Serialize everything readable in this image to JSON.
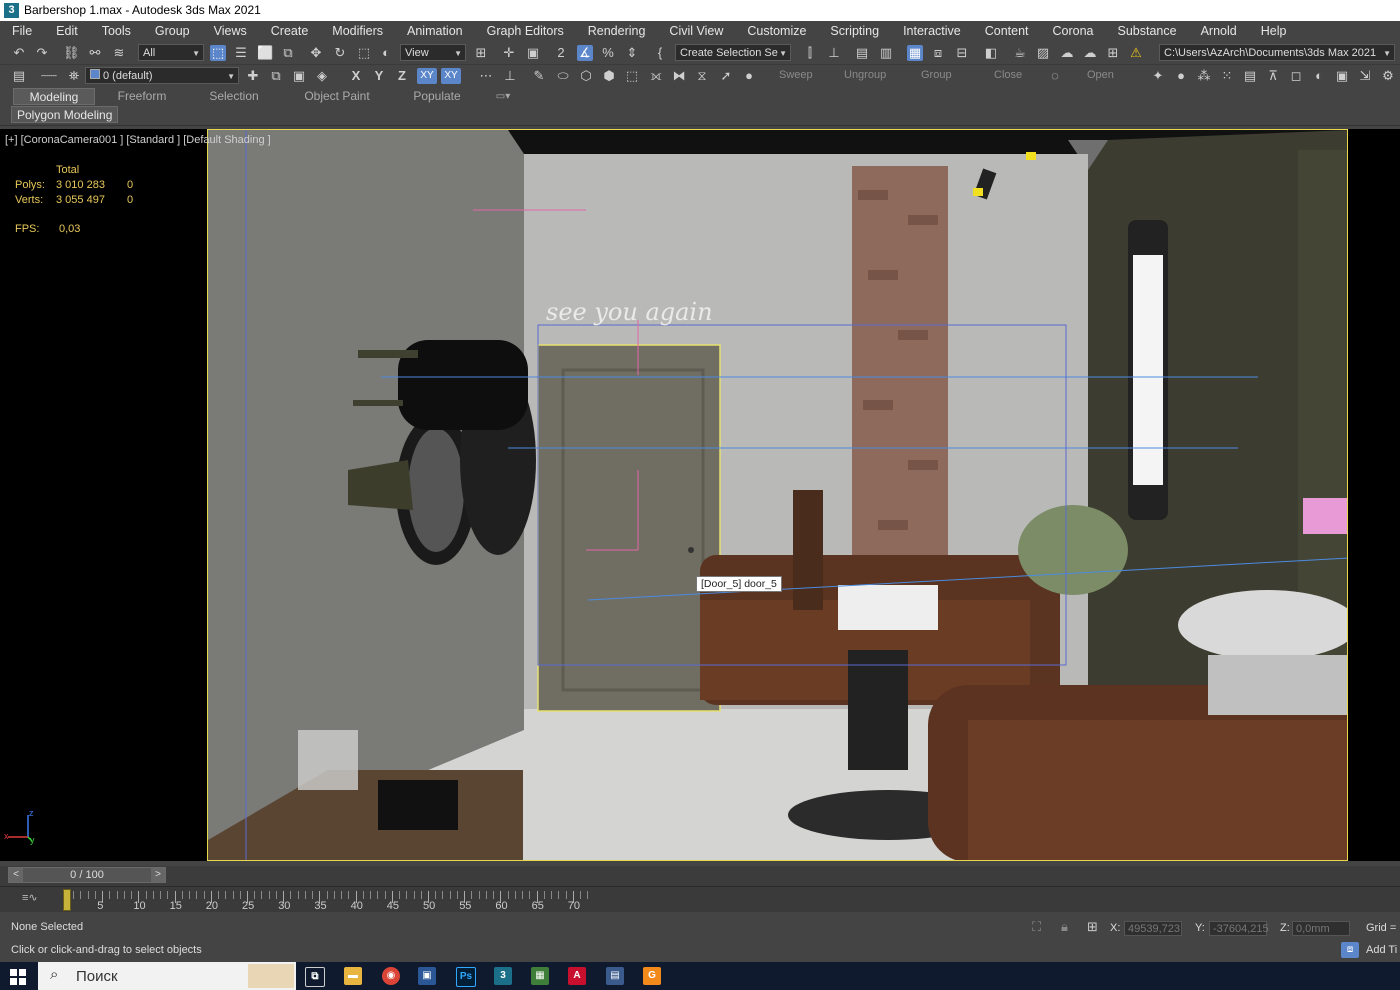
{
  "window": {
    "title": "Barbershop 1.max - Autodesk 3ds Max 2021",
    "app_icon": "3"
  },
  "menu": [
    "File",
    "Edit",
    "Tools",
    "Group",
    "Views",
    "Create",
    "Modifiers",
    "Animation",
    "Graph Editors",
    "Rendering",
    "Civil View",
    "Customize",
    "Scripting",
    "Interactive",
    "Content",
    "Corona",
    "Substance",
    "Arnold",
    "Help"
  ],
  "toolbar1": {
    "filter_select": "All",
    "ref_coord": "View",
    "named_selection": "Create Selection Se",
    "project_path": "C:\\Users\\AzArch\\Documents\\3ds Max 2021"
  },
  "toolbar2": {
    "layer": "0 (default)",
    "axis_x": "X",
    "axis_y": "Y",
    "axis_z": "Z",
    "plane_xy": "XY",
    "plane_xy2": "XY",
    "sweep": "Sweep",
    "ungroup": "Ungroup",
    "group": "Group",
    "close": "Close",
    "open": "Open"
  },
  "ribbon": {
    "tabs": [
      "Modeling",
      "Freeform",
      "Selection",
      "Object Paint",
      "Populate"
    ],
    "active_tab": "Modeling",
    "panel_label": "Polygon Modeling"
  },
  "viewport": {
    "label": "[+] [CoronaCamera001 ] [Standard ] [Default Shading ]",
    "stats": {
      "header": "Total",
      "polys_label": "Polys:",
      "polys_total": "3 010 283",
      "polys_sel": "0",
      "verts_label": "Verts:",
      "verts_total": "3 055 497",
      "verts_sel": "0",
      "fps_label": "FPS:",
      "fps_value": "0,03"
    },
    "tooltip": "[Door_5] door_5",
    "scene_text": "see you again",
    "axis_labels": {
      "z": "z",
      "x": "x",
      "y": "y"
    }
  },
  "timeline": {
    "frame_display": "0 / 100",
    "prev": "<",
    "next": ">",
    "tick_labels": [
      "0",
      "5",
      "10",
      "15",
      "20",
      "25",
      "30",
      "35",
      "40",
      "45",
      "50",
      "55",
      "60",
      "65",
      "70"
    ]
  },
  "status": {
    "selection": "None Selected",
    "prompt": "Click or click-and-drag to select objects",
    "x_label": "X:",
    "x_value": "49539,723",
    "y_label": "Y:",
    "y_value": "-37604,215",
    "z_label": "Z:",
    "z_value": "0,0mm",
    "grid_label": "Grid =",
    "add_time_tag": "Add Ti"
  },
  "taskbar": {
    "search_placeholder": "Поиск"
  },
  "colors": {
    "accent": "#5b86c9",
    "viewport_border": "#e6d84a",
    "stats": "#e8c85a"
  }
}
